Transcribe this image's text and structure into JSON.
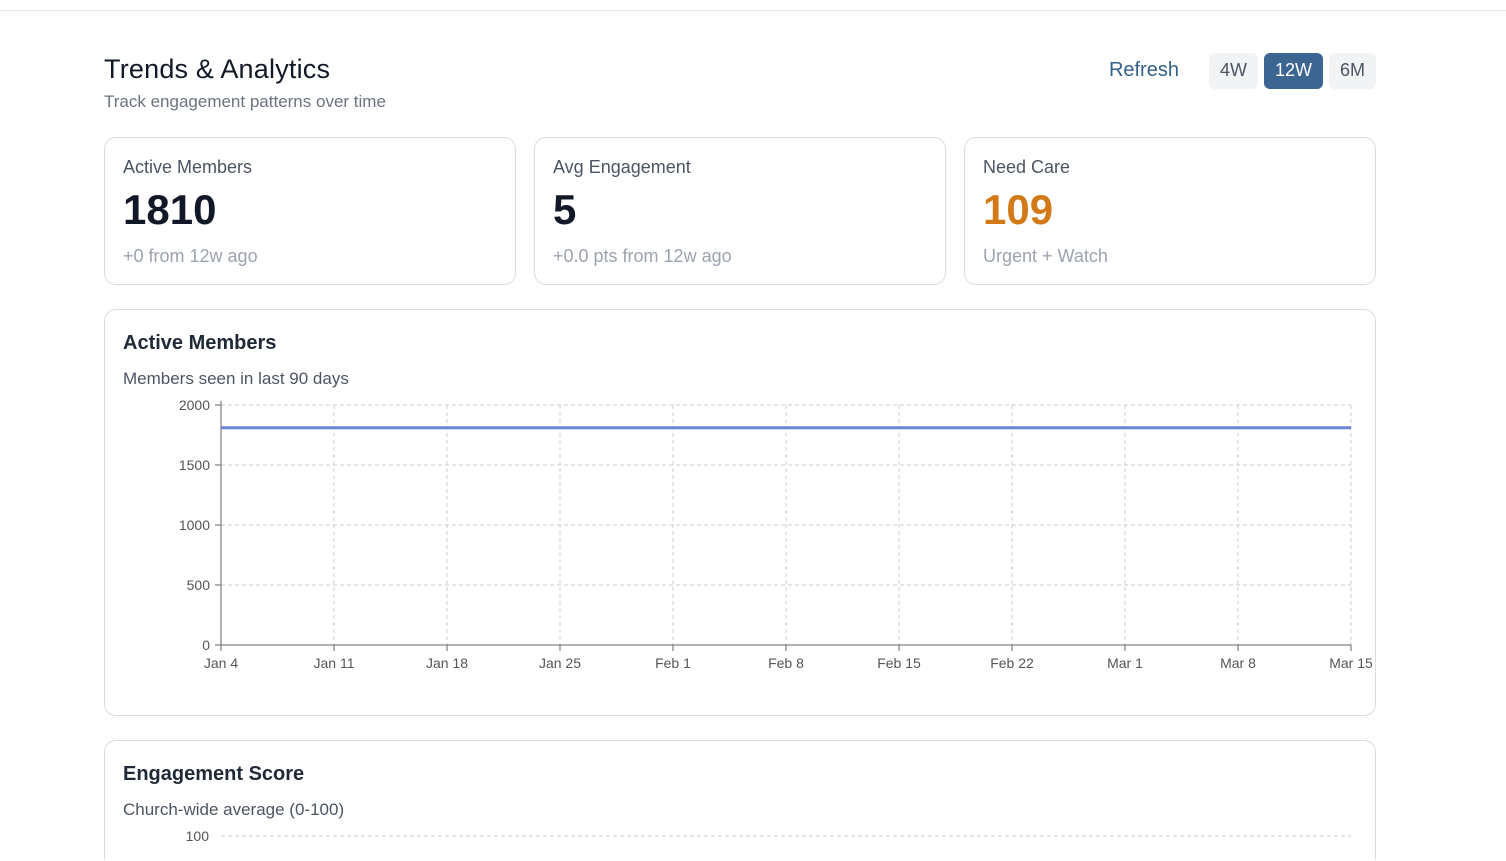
{
  "header": {
    "title": "Trends & Analytics",
    "subtitle": "Track engagement patterns over time",
    "refresh_label": "Refresh",
    "ranges": [
      "4W",
      "12W",
      "6M"
    ],
    "active_range": "12W"
  },
  "stats": [
    {
      "label": "Active Members",
      "value": "1810",
      "note": "+0 from 12w ago"
    },
    {
      "label": "Avg Engagement",
      "value": "5",
      "note": "+0.0 pts from 12w ago"
    },
    {
      "label": "Need Care",
      "value": "109",
      "note": "Urgent + Watch",
      "value_color": "#d27a17"
    }
  ],
  "active_members_chart": {
    "title": "Active Members",
    "subtitle": "Members seen in last 90 days"
  },
  "engagement_chart": {
    "title": "Engagement Score",
    "subtitle": "Church-wide average (0-100)",
    "first_tick": "100"
  },
  "colors": {
    "accent": "#3d6592",
    "line": "#6b85d8",
    "warning": "#d27a17"
  },
  "chart_data": [
    {
      "type": "line",
      "title": "Active Members",
      "subtitle": "Members seen in last 90 days",
      "x": [
        "Jan 4",
        "Jan 11",
        "Jan 18",
        "Jan 25",
        "Feb 1",
        "Feb 8",
        "Feb 15",
        "Feb 22",
        "Mar 1",
        "Mar 8",
        "Mar 15"
      ],
      "series": [
        {
          "values": [
            1810,
            1810,
            1810,
            1810,
            1810,
            1810,
            1810,
            1810,
            1810,
            1810,
            1810
          ]
        }
      ],
      "yticks": [
        0,
        500,
        1000,
        1500,
        2000
      ],
      "ylim": [
        0,
        2000
      ],
      "grid": true
    }
  ]
}
